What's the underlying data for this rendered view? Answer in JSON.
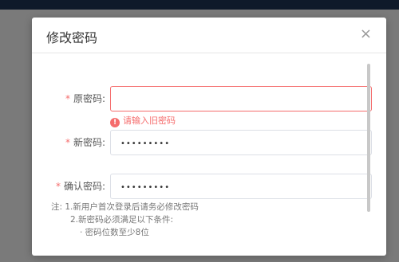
{
  "dialog": {
    "title": "修改密码",
    "close_icon": "×"
  },
  "form": {
    "old_password": {
      "required_mark": "*",
      "label": "原密码:",
      "value": ""
    },
    "old_password_error": {
      "icon": "!",
      "text": "请输入旧密码"
    },
    "new_password": {
      "required_mark": "*",
      "label": "新密码:",
      "value": "•••••••••"
    },
    "confirm_password": {
      "required_mark": "*",
      "label": "确认密码:",
      "value": "•••••••••"
    }
  },
  "notes": [
    "注:  1.新用户首次登录后请务必修改密码",
    "2.新密码必须满足以下条件:",
    "· 密码位数至少8位"
  ],
  "colors": {
    "error": "#f56c6c",
    "border": "#dcdfe6",
    "overlay": "#7a7a7a"
  }
}
